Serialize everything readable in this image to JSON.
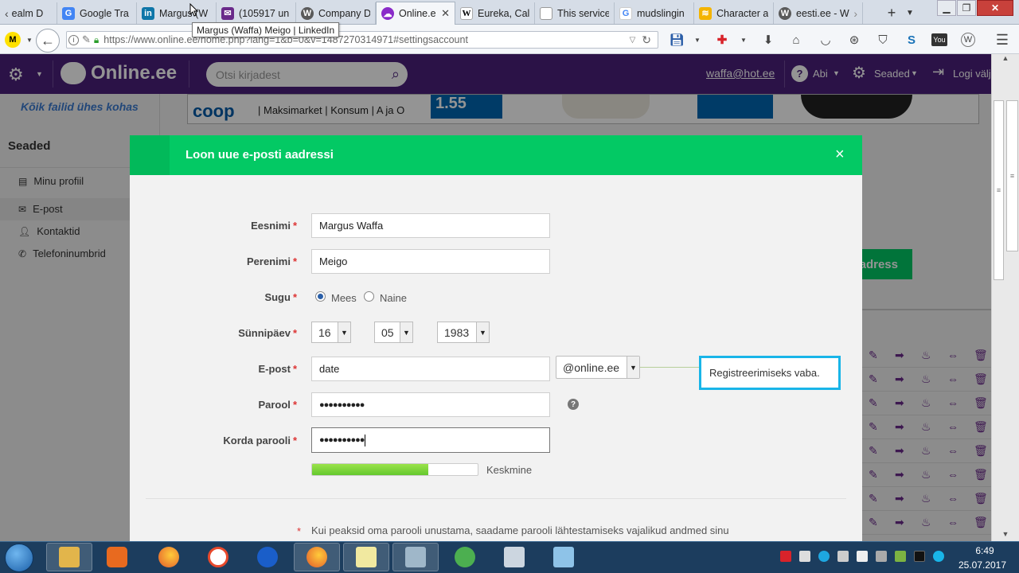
{
  "browser": {
    "tabs": [
      {
        "label": "ealm D",
        "icon_color": "#6b7b8c",
        "icon": "scroll-left-icon"
      },
      {
        "label": "Google Tra",
        "icon_color": "#4285f4",
        "icon": "google-translate-icon"
      },
      {
        "label": "Margus (W",
        "icon_color": "#0e76a8",
        "icon": "linkedin-icon",
        "icon_text": "in"
      },
      {
        "label": "(105917 un",
        "icon_color": "#6a2a8a",
        "icon": "mail-icon"
      },
      {
        "label": "Company D",
        "icon_color": "#5a5a5a",
        "icon": "wordpress-icon",
        "icon_text": "W"
      },
      {
        "label": "Online.e",
        "icon_color": "#8a2bc9",
        "icon": "online-ee-cloud-icon"
      },
      {
        "label": "Eureka, Cal",
        "icon_color": "#ffffff",
        "icon": "wikipedia-icon",
        "icon_text": "W"
      },
      {
        "label": "This service",
        "icon_color": "#ffffff",
        "icon": "blank-page-icon"
      },
      {
        "label": "mudslingin",
        "icon_color": "#ffffff",
        "icon": "google-icon",
        "icon_text": "G"
      },
      {
        "label": "Character a",
        "icon_color": "#f4b400",
        "icon": "character-icon"
      },
      {
        "label": "eesti.ee - W",
        "icon_color": "#5a5a5a",
        "icon": "wordpress-icon",
        "icon_text": "W"
      }
    ],
    "tooltip": "Margus (Waffa) Meigo | LinkedIn",
    "url": "https://www.online.ee/home.php?lang=1&b=0&v=1487270314971#settingsaccount",
    "url_host": "online.ee"
  },
  "site": {
    "logo": "Online.ee",
    "search_placeholder": "Otsi kirjadest",
    "user_email": "waffa@hot.ee",
    "help": "Abi",
    "settings": "Seaded",
    "logout": "Logi välja",
    "tagline": "Kõik failid ühes kohas",
    "ad_text": "| Maksimarket | Konsum | A ja O",
    "ad_price": "1.55",
    "ad_brand": "coop",
    "sidebar_title": "Seaded",
    "sidebar_items": [
      "Minu profiil",
      "E-post",
      "Kontaktid",
      "Telefoninumbrid"
    ],
    "right_button": "adress"
  },
  "modal": {
    "title": "Loon uue e-posti aadressi",
    "close": "×",
    "first_name_label": "Eesnimi",
    "first_name": "Margus Waffa",
    "last_name_label": "Perenimi",
    "last_name": "Meigo",
    "gender_label": "Sugu",
    "gender_male": "Mees",
    "gender_female": "Naine",
    "birthday_label": "Sünnipäev",
    "day": "16",
    "month": "05",
    "year": "1983",
    "email_label": "E-post",
    "email_value": "date",
    "domain": "@online.ee",
    "availability": "Registreerimiseks vaba.",
    "password_label": "Parool",
    "password": "●●●●●●●●●●",
    "repeat_label": "Korda parooli",
    "repeat": "●●●●●●●●●●",
    "strength_text": "Keskmine",
    "strength_fraction": 0.7,
    "footnote_star": "*",
    "footnote": "Kui peaksid oma parooli unustama, saadame parooli lähtestamiseks vajalikud andmed sinu"
  },
  "taskbar": {
    "time": "6:49",
    "date": "25.07.2017"
  }
}
